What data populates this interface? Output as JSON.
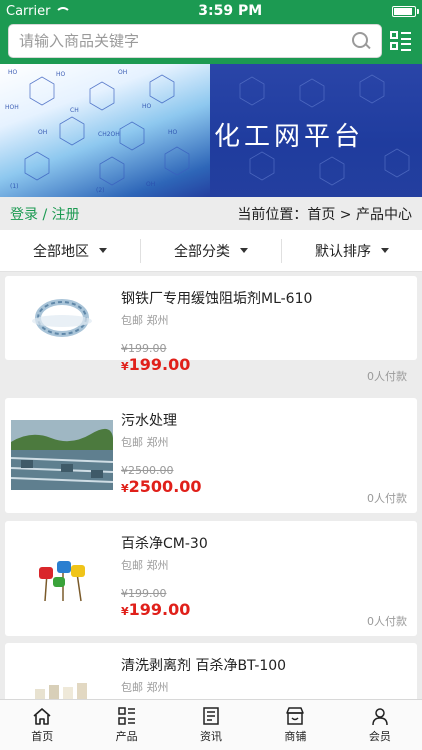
{
  "status_bar": {
    "carrier": "Carrier",
    "time": "3:59 PM"
  },
  "search": {
    "placeholder": "请输入商品关键字"
  },
  "banner": {
    "title": "化工网平台"
  },
  "breadcrumb": {
    "auth_text": "登录 / 注册",
    "location_text": "当前位置：首页 > 产品中心"
  },
  "filters": [
    {
      "label": "全部地区"
    },
    {
      "label": "全部分类"
    },
    {
      "label": "默认排序"
    }
  ],
  "products": [
    {
      "title": "钢铁厂专用缓蚀阻垢剂ML-610",
      "location": "包邮 郑州",
      "old_price": "¥199.00",
      "price_symbol": "¥",
      "price": "199.00",
      "sold": "0人付款",
      "image": "water-ring-image"
    },
    {
      "title": "污水处理",
      "location": "包邮 郑州",
      "old_price": "¥2500.00",
      "price_symbol": "¥",
      "price": "2500.00",
      "sold": "0人付款",
      "image": "wastewater-plant-image"
    },
    {
      "title": "百杀净CM-30",
      "location": "包邮 郑州",
      "old_price": "¥199.00",
      "price_symbol": "¥",
      "price": "199.00",
      "sold": "0人付款",
      "image": "chemical-barrels-image"
    },
    {
      "title": "清洗剥离剂 百杀净BT-100",
      "location": "包邮 郑州",
      "old_price": "",
      "price_symbol": "",
      "price": "",
      "sold": "",
      "image": "bottles-image"
    }
  ],
  "tabbar": [
    {
      "label": "首页",
      "icon": "home-icon"
    },
    {
      "label": "产品",
      "icon": "grid-list-icon"
    },
    {
      "label": "资讯",
      "icon": "news-icon"
    },
    {
      "label": "商铺",
      "icon": "shop-icon"
    },
    {
      "label": "会员",
      "icon": "user-icon"
    }
  ],
  "colors": {
    "brand_green": "#1c9a52",
    "price_red": "#e0201a",
    "banner_blue": "#243f9f"
  }
}
